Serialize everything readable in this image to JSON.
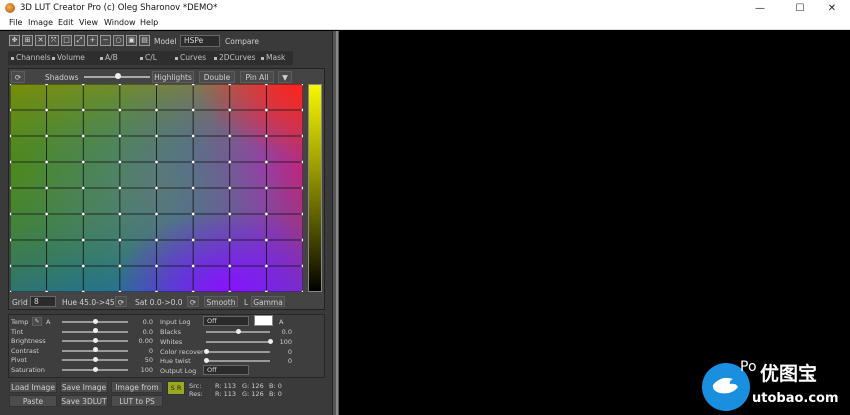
{
  "window": {
    "title": "3D LUT Creator Pro (c) Oleg Sharonov *DEMO*",
    "controls": [
      "—",
      "☐",
      "✕"
    ]
  },
  "menu": [
    "File",
    "Image",
    "Edit",
    "View",
    "Window",
    "Help"
  ],
  "toolbar": {
    "model_label": "Model",
    "model_value": "HSPe",
    "compare_label": "Compare"
  },
  "tabs": [
    "Channels",
    "Volume",
    "A/B",
    "C/L",
    "Curves",
    "2DCurves",
    "Mask"
  ],
  "grid_header": {
    "shadows": "Shadows",
    "highlights": "Highlights",
    "double": "Double",
    "pin_all": "Pin All"
  },
  "grid_footer": {
    "grid_label": "Grid",
    "grid_value": "8",
    "hue": "Hue 45.0->45.0",
    "sat": "Sat 0.0->0.0",
    "smooth": "Smooth",
    "l_label": "L",
    "gamma": "Gamma"
  },
  "left_params": [
    {
      "label": "Temp",
      "value": "0.0",
      "pos": 0.5
    },
    {
      "label": "Tint",
      "value": "0.0",
      "pos": 0.5
    },
    {
      "label": "Brightness",
      "value": "0.00",
      "pos": 0.5
    },
    {
      "label": "Contrast",
      "value": "0",
      "pos": 0.5
    },
    {
      "label": "Pivot",
      "value": "50",
      "pos": 0.5
    },
    {
      "label": "Saturation",
      "value": "100",
      "pos": 0.5
    }
  ],
  "temp_extra": "A",
  "right_params": {
    "input_log_label": "Input Log",
    "input_log_value": "Off",
    "input_a": "A",
    "blacks": {
      "label": "Blacks",
      "value": "0.0",
      "pos": 0.5
    },
    "whites": {
      "label": "Whites",
      "value": "100",
      "pos": 1.0
    },
    "color_recover": {
      "label": "Color recover",
      "value": "0",
      "pos": 0.0
    },
    "hue_twist": {
      "label": "Hue twist",
      "value": "0",
      "pos": 0.0
    },
    "output_log_label": "Output Log",
    "output_log_value": "Off"
  },
  "buttons": {
    "load_image": "Load Image",
    "save_image": "Save Image",
    "image_from_ps": "Image from PS",
    "paste": "Paste",
    "save_3dlut": "Save 3DLUT",
    "lut_to_ps": "LUT to PS",
    "s_btn": "S",
    "r_btn": "R"
  },
  "readout": {
    "src_label": "Src:",
    "res_label": "Res:",
    "src_r": "R: 113",
    "src_g": "G: 126",
    "src_b": "B: 0",
    "res_r": "R: 113",
    "res_g": "G: 126",
    "res_b": "B: 0"
  },
  "watermark": {
    "text1": "Po",
    "text2": "优图宝",
    "url": "utobao.com"
  }
}
